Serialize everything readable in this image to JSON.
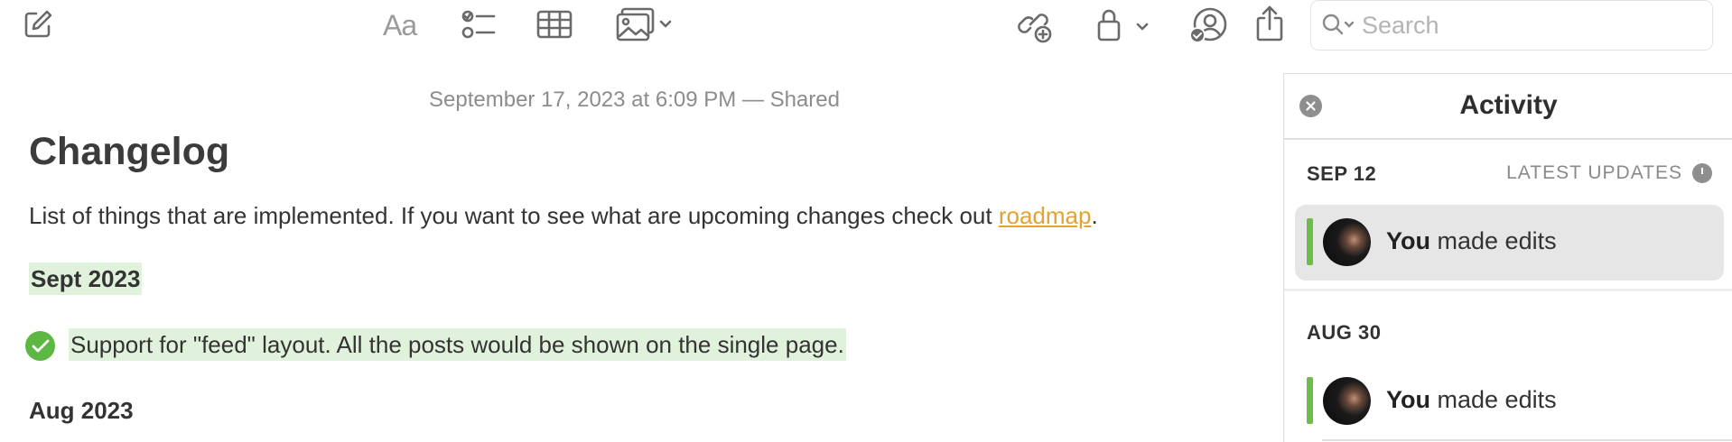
{
  "toolbar": {
    "format_label": "Aa",
    "search": {
      "placeholder": "Search"
    }
  },
  "note": {
    "date": "September 17, 2023 at 6:09 PM — Shared",
    "title": "Changelog",
    "intro_text": "List of things that are implemented. If you want to see what are upcoming changes check out ",
    "intro_link": "roadmap",
    "intro_end": ".",
    "sections": [
      {
        "heading": "Sept 2023",
        "tasks": [
          {
            "text": "Support for \"feed\" layout. All the posts would be shown on the single page.",
            "done": true
          }
        ]
      },
      {
        "heading": "Aug 2023"
      }
    ]
  },
  "activity": {
    "title": "Activity",
    "latest_label": "LATEST UPDATES",
    "groups": [
      {
        "date": "SEP 12",
        "items": [
          {
            "actor": "You",
            "action": "made edits"
          }
        ]
      },
      {
        "date": "AUG 30",
        "items": [
          {
            "actor": "You",
            "action": "made edits"
          }
        ]
      }
    ]
  },
  "colors": {
    "accent_link": "#e4a32d",
    "highlight": "#e1f2dc",
    "check_green": "#5cb843",
    "activity_bar": "#6cbd49"
  }
}
